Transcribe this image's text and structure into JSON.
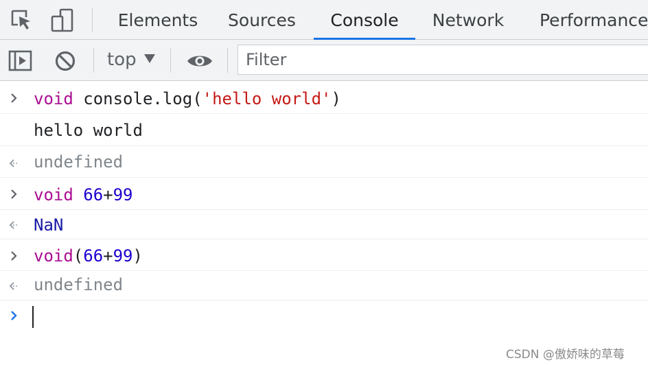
{
  "tabs": [
    {
      "label": "Elements",
      "active": false
    },
    {
      "label": "Sources",
      "active": false
    },
    {
      "label": "Console",
      "active": true
    },
    {
      "label": "Network",
      "active": false
    },
    {
      "label": "Performance",
      "active": false
    }
  ],
  "toolbar": {
    "context_label": "top",
    "filter_placeholder": "Filter"
  },
  "console_lines": [
    {
      "kind": "input",
      "parts": [
        {
          "t": "void",
          "cls": "kw"
        },
        {
          "t": " console.log(",
          "cls": "plain"
        },
        {
          "t": "'hello world'",
          "cls": "str"
        },
        {
          "t": ")",
          "cls": "plain"
        }
      ]
    },
    {
      "kind": "log",
      "parts": [
        {
          "t": "hello world",
          "cls": "plain"
        }
      ]
    },
    {
      "kind": "result",
      "parts": [
        {
          "t": "undefined",
          "cls": "muted"
        }
      ]
    },
    {
      "kind": "input",
      "parts": [
        {
          "t": "void",
          "cls": "kw"
        },
        {
          "t": " ",
          "cls": "plain"
        },
        {
          "t": "66",
          "cls": "num"
        },
        {
          "t": "+",
          "cls": "plain"
        },
        {
          "t": "99",
          "cls": "num"
        }
      ]
    },
    {
      "kind": "result",
      "parts": [
        {
          "t": "NaN",
          "cls": "nan"
        }
      ]
    },
    {
      "kind": "input",
      "parts": [
        {
          "t": "void",
          "cls": "kw"
        },
        {
          "t": "(",
          "cls": "plain"
        },
        {
          "t": "66",
          "cls": "num"
        },
        {
          "t": "+",
          "cls": "plain"
        },
        {
          "t": "99",
          "cls": "num"
        },
        {
          "t": ")",
          "cls": "plain"
        }
      ]
    },
    {
      "kind": "result",
      "parts": [
        {
          "t": "undefined",
          "cls": "muted"
        }
      ]
    }
  ],
  "icons": {
    "inspect": "inspect-element-icon",
    "device": "device-toolbar-icon",
    "sidebar": "show-sidebar-icon",
    "clear": "clear-console-icon",
    "eye": "live-expression-icon",
    "input_prompt": "chevron-right-icon",
    "result_prompt": "return-arrow-icon"
  },
  "colors": {
    "active_tab_underline": "#1a73e8",
    "keyword": "#aa0d91",
    "string": "#c41a16",
    "number": "#1c00cf",
    "prompt_active": "#1a73e8"
  },
  "watermark": "CSDN @傲娇味的草莓"
}
